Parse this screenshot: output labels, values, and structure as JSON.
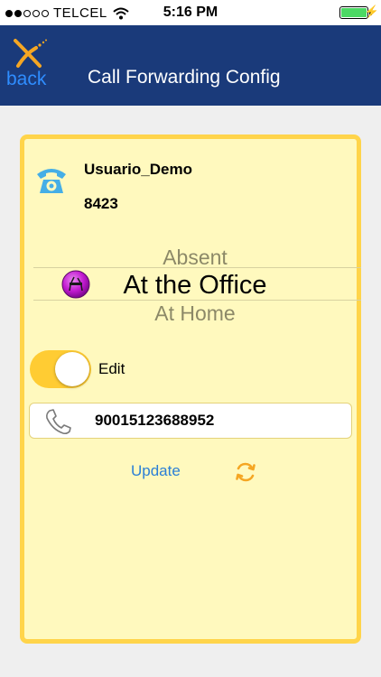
{
  "status_bar": {
    "carrier": "TELCEL",
    "time": "5:16 PM"
  },
  "nav": {
    "back_label": "back",
    "title": "Call Forwarding Config"
  },
  "user": {
    "name": "Usuario_Demo",
    "extension": "8423"
  },
  "picker": {
    "options": [
      "Absent",
      "At the Office",
      "At Home"
    ],
    "selected": "At the Office"
  },
  "edit": {
    "label": "Edit",
    "enabled": true
  },
  "forward_number": {
    "value": "90015123688952"
  },
  "actions": {
    "update_label": "Update"
  },
  "colors": {
    "nav_bg": "#1a3a7a",
    "card_bg": "#fff9be",
    "card_border": "#ffd44a",
    "toggle_on": "#ffcc33",
    "link_blue": "#2b7fd6",
    "refresh_orange": "#f5a623"
  },
  "icons": {
    "wifi": "wifi-icon",
    "battery": "battery-icon",
    "charging": "charging-bolt-icon",
    "back_logo": "x-logo-icon",
    "user_phone": "telephone-icon",
    "status": "status-circle-icon",
    "forward": "handset-icon",
    "refresh": "refresh-icon"
  }
}
